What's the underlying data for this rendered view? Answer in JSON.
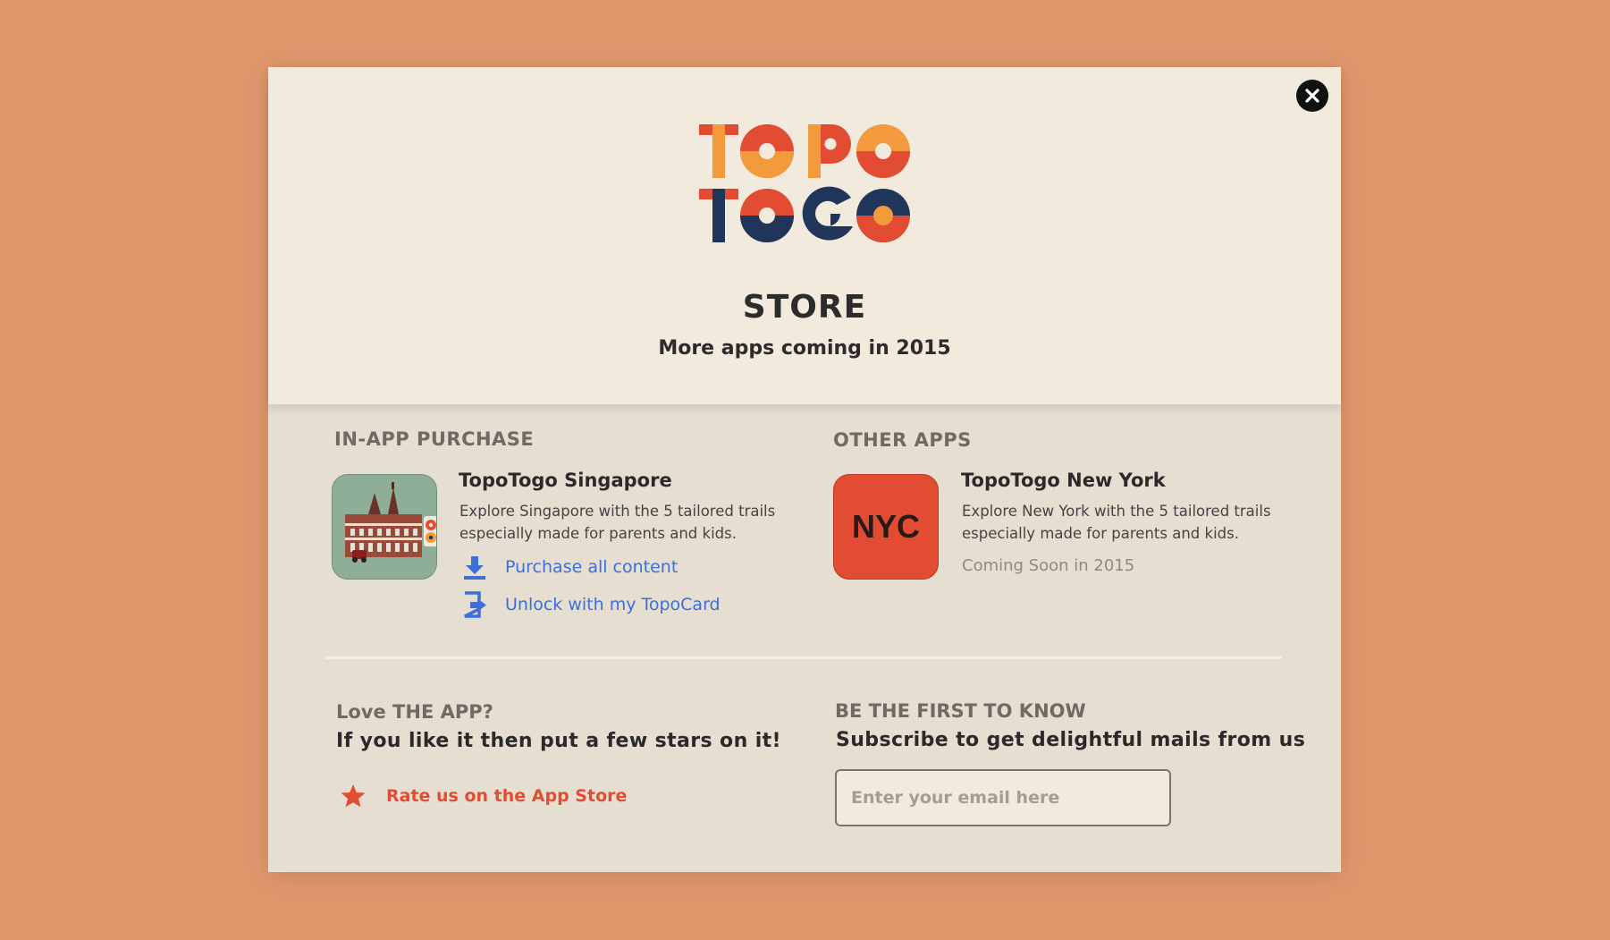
{
  "colors": {
    "background": "#e1976c",
    "panel_top": "#f2eadd",
    "panel_bottom": "#e7ded2",
    "logo_red": "#e24c33",
    "logo_orange": "#f29a3c",
    "logo_navy": "#1f3559",
    "link_blue": "#3d6fd8"
  },
  "header": {
    "logo_line1": "TOPO",
    "logo_line2": "TOGO",
    "title": "STORE",
    "subtitle": "More apps coming in 2015",
    "close_icon": "close-icon"
  },
  "in_app": {
    "heading": "IN-APP PURCHASE",
    "app_name": "TopoTogo Singapore",
    "description": "Explore Singapore with the 5 tailored trails especially made for parents and kids.",
    "purchase_label": "Purchase all content",
    "unlock_label": "Unlock with my TopoCard",
    "icons": [
      "download-icon",
      "unlock-card-icon"
    ]
  },
  "other_apps": {
    "heading": "OTHER APPS",
    "app_name": "TopoTogo New York",
    "icon_text": "NYC",
    "description": "Explore New York with the 5 tailored trails especially made for parents and kids.",
    "status": "Coming Soon in 2015"
  },
  "love": {
    "heading": "Love THE APP?",
    "subheading": "If you like it then put a few stars on it!",
    "rate_label": "Rate us on the App Store",
    "icon": "star-icon"
  },
  "subscribe": {
    "heading": "BE THE FIRST TO KNOW",
    "subheading": "Subscribe to get delightful mails from us",
    "email_placeholder": "Enter your email here",
    "email_value": ""
  }
}
